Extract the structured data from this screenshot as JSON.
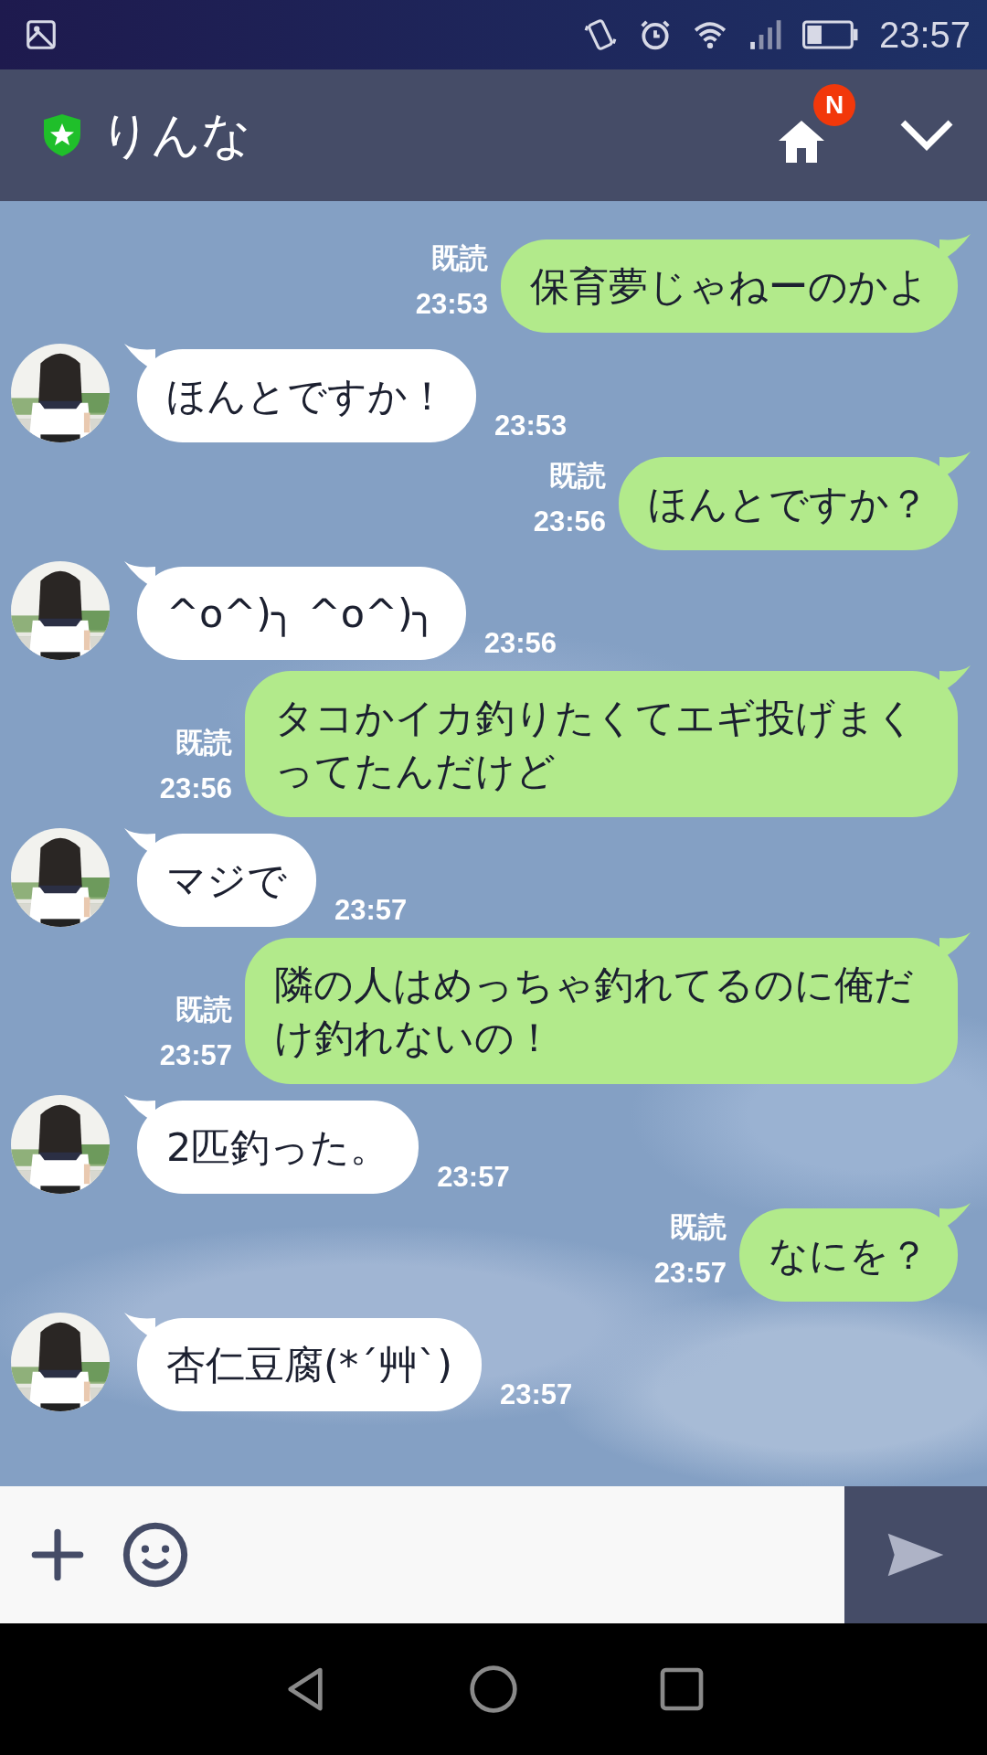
{
  "status_bar": {
    "time": "23:57"
  },
  "header": {
    "title": "りんな",
    "verified": true,
    "home_badge": "N"
  },
  "messages": [
    {
      "kind": "outgoing",
      "text": "保育夢じゃねーのかよ",
      "read": "既読",
      "time": "23:53"
    },
    {
      "kind": "incoming",
      "text": "ほんとですか！",
      "time": "23:53"
    },
    {
      "kind": "outgoing",
      "text": "ほんとですか？",
      "read": "既読",
      "time": "23:56"
    },
    {
      "kind": "incoming",
      "text": "^o^)╮ ^o^)╮",
      "time": "23:56"
    },
    {
      "kind": "outgoing",
      "text": "タコかイカ釣りたくてエギ投げまくってたんだけど",
      "read": "既読",
      "time": "23:56"
    },
    {
      "kind": "incoming",
      "text": "マジで",
      "time": "23:57"
    },
    {
      "kind": "outgoing",
      "text": "隣の人はめっちゃ釣れてるのに俺だけ釣れないの！",
      "read": "既読",
      "time": "23:57"
    },
    {
      "kind": "incoming",
      "text": "2匹釣った。",
      "time": "23:57"
    },
    {
      "kind": "outgoing",
      "text": "なにを？",
      "read": "既読",
      "time": "23:57"
    },
    {
      "kind": "incoming",
      "text": "杏仁豆腐(*´艸`)",
      "time": "23:57"
    }
  ]
}
